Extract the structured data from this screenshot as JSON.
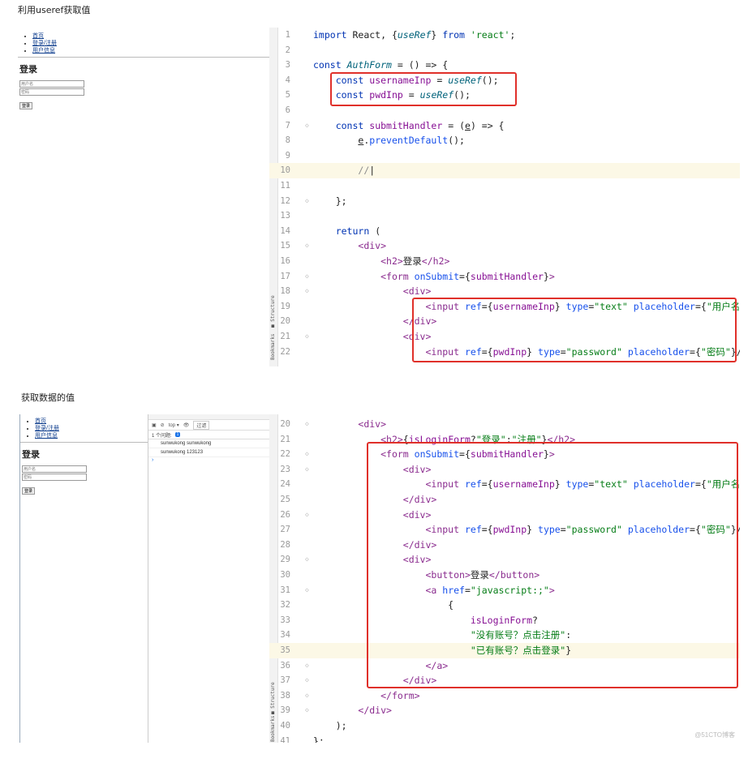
{
  "headings": [
    "利用useref获取值",
    "获取数据的值"
  ],
  "browser": {
    "nav": [
      "首页",
      "登录/注册",
      "用户信息"
    ],
    "title": "登录",
    "username_placeholder": "用户名",
    "password_placeholder": "密码",
    "login_button": "登录"
  },
  "devtools": {
    "context": "top ▾",
    "filter": "过滤",
    "issues_label": "1 个问题:",
    "issues_count": "1",
    "logs": [
      "sunwukong  sunwukong",
      "sunwukong  123123"
    ],
    "prompt": "›"
  },
  "watermark": "@51CTO博客",
  "colors": {
    "highlight_box": "#e0302a",
    "current_line": "#fcf8e6"
  }
}
